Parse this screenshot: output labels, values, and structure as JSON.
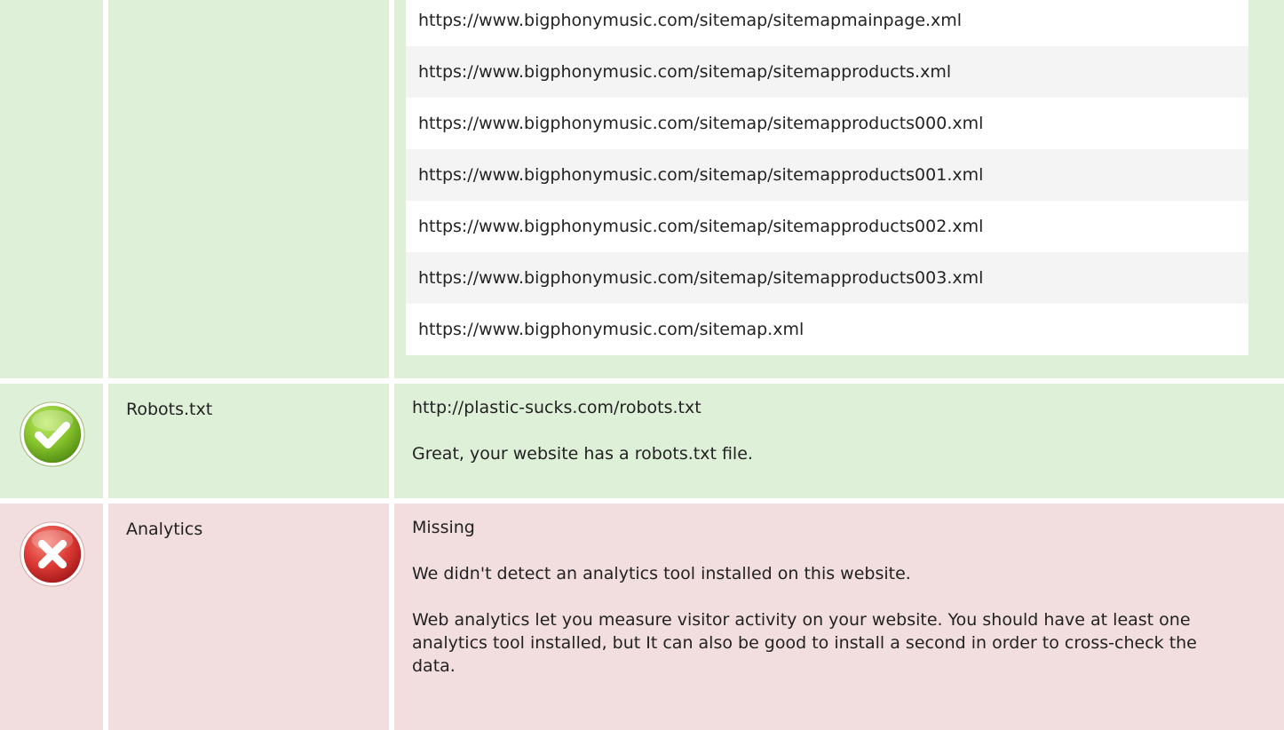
{
  "sitemap": {
    "urls": [
      "https://www.bigphonymusic.com/sitemap/sitemapmainpage.xml",
      "https://www.bigphonymusic.com/sitemap/sitemapproducts.xml",
      "https://www.bigphonymusic.com/sitemap/sitemapproducts000.xml",
      "https://www.bigphonymusic.com/sitemap/sitemapproducts001.xml",
      "https://www.bigphonymusic.com/sitemap/sitemapproducts002.xml",
      "https://www.bigphonymusic.com/sitemap/sitemapproducts003.xml",
      "https://www.bigphonymusic.com/sitemap.xml"
    ]
  },
  "robots": {
    "status_icon": "check-icon",
    "label": "Robots.txt",
    "url": "http://plastic-sucks.com/robots.txt",
    "message": "Great, your website has a robots.txt file."
  },
  "analytics": {
    "status_icon": "cross-icon",
    "label": "Analytics",
    "status": "Missing",
    "message": "We didn't detect an analytics tool installed on this website.",
    "advice": "Web analytics let you measure visitor activity on your website. You should have at least one analytics tool installed, but It can also be good to install a second in order to cross-check the data."
  },
  "colors": {
    "pass_bg": "#dff0d8",
    "fail_bg": "#f2dede",
    "check_green": "#7ab829",
    "cross_red": "#d33a3a"
  }
}
